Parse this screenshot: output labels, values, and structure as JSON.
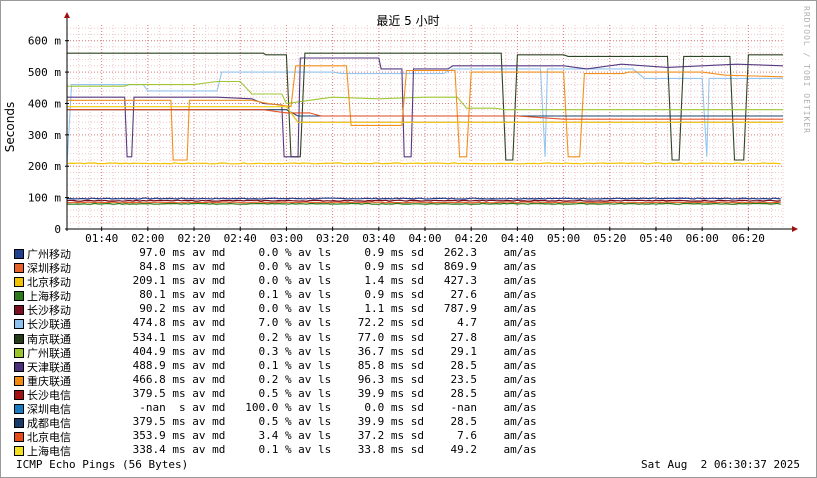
{
  "chart_data": {
    "type": "line",
    "title": "最近 5 小时",
    "ylabel": "Seconds",
    "side_label": "RRDTOOL / TOBI OETIKER",
    "ylim": [
      0,
      650
    ],
    "yticks": [
      0,
      100,
      200,
      300,
      400,
      500,
      600
    ],
    "ytick_labels": [
      "0",
      "100 m",
      "200 m",
      "300 m",
      "400 m",
      "500 m",
      "600 m"
    ],
    "x_start_minutes": 85,
    "x_end_minutes": 395,
    "x_tick_minutes": [
      100,
      120,
      140,
      160,
      180,
      200,
      220,
      240,
      260,
      280,
      300,
      320,
      340,
      360,
      380
    ],
    "xtick_labels": [
      "01:40",
      "02:00",
      "02:20",
      "02:40",
      "03:00",
      "03:20",
      "03:40",
      "04:00",
      "04:20",
      "04:40",
      "05:00",
      "05:20",
      "05:40",
      "06:00",
      "06:20"
    ],
    "grid": true,
    "series": [
      {
        "name": "广州移动",
        "color": "#1f3f8f",
        "kind": "flat",
        "base": 97,
        "stats": "  97.0 ms av md     0.0 % av ls     0.9 ms sd   262.3    am/as"
      },
      {
        "name": "深圳移动",
        "color": "#e8602a",
        "kind": "flat",
        "base": 84.8,
        "stats": "  84.8 ms av md     0.0 % av ls     0.9 ms sd   869.9    am/as"
      },
      {
        "name": "北京移动",
        "color": "#f2c200",
        "kind": "flat",
        "base": 209.1,
        "stats": " 209.1 ms av md     0.0 % av ls     1.4 ms sd   427.3    am/as"
      },
      {
        "name": "上海移动",
        "color": "#2c7a1a",
        "kind": "flat",
        "base": 80.1,
        "stats": "  80.1 ms av md     0.1 % av ls     0.9 ms sd    27.6    am/as"
      },
      {
        "name": "长沙移动",
        "color": "#7a0f1f",
        "kind": "flat",
        "base": 90.2,
        "stats": "  90.2 ms av md     0.0 % av ls     1.1 ms sd   787.9    am/as"
      },
      {
        "name": "长沙联通",
        "color": "#8fc3ef",
        "kind": "step",
        "points": [
          [
            85,
            205
          ],
          [
            87,
            460
          ],
          [
            118,
            460
          ],
          [
            120,
            440
          ],
          [
            150,
            440
          ],
          [
            152,
            500
          ],
          [
            200,
            500
          ],
          [
            204,
            495
          ],
          [
            248,
            495
          ],
          [
            252,
            510
          ],
          [
            290,
            510
          ],
          [
            292,
            230
          ],
          [
            293,
            510
          ],
          [
            330,
            510
          ],
          [
            335,
            480
          ],
          [
            360,
            480
          ],
          [
            362,
            230
          ],
          [
            363,
            480
          ],
          [
            395,
            480
          ]
        ],
        "stats": " 474.8 ms av md     7.0 % av ls    72.2 ms sd     4.7    am/as"
      },
      {
        "name": "南京联通",
        "color": "#243a18",
        "kind": "step",
        "points": [
          [
            85,
            560
          ],
          [
            170,
            560
          ],
          [
            171,
            555
          ],
          [
            180,
            555
          ],
          [
            182,
            230
          ],
          [
            186,
            230
          ],
          [
            188,
            560
          ],
          [
            273,
            560
          ],
          [
            275,
            220
          ],
          [
            278,
            220
          ],
          [
            280,
            555
          ],
          [
            300,
            555
          ],
          [
            302,
            550
          ],
          [
            345,
            550
          ],
          [
            347,
            220
          ],
          [
            350,
            220
          ],
          [
            352,
            550
          ],
          [
            372,
            550
          ],
          [
            374,
            220
          ],
          [
            378,
            220
          ],
          [
            380,
            555
          ],
          [
            395,
            555
          ]
        ],
        "stats": " 534.1 ms av md     0.2 % av ls    77.0 ms sd    27.8    am/as"
      },
      {
        "name": "广州联通",
        "color": "#9ac52a",
        "kind": "step",
        "points": [
          [
            85,
            455
          ],
          [
            110,
            455
          ],
          [
            112,
            460
          ],
          [
            140,
            460
          ],
          [
            150,
            470
          ],
          [
            160,
            470
          ],
          [
            165,
            430
          ],
          [
            178,
            430
          ],
          [
            180,
            400
          ],
          [
            190,
            410
          ],
          [
            200,
            420
          ],
          [
            220,
            415
          ],
          [
            240,
            420
          ],
          [
            254,
            420
          ],
          [
            258,
            385
          ],
          [
            270,
            385
          ],
          [
            275,
            380
          ],
          [
            395,
            380
          ]
        ],
        "stats": " 404.9 ms av md     0.3 % av ls    36.7 ms sd    29.1    am/as"
      },
      {
        "name": "天津联通",
        "color": "#4c2f7a",
        "kind": "step",
        "points": [
          [
            85,
            420
          ],
          [
            110,
            420
          ],
          [
            111,
            230
          ],
          [
            113,
            230
          ],
          [
            114,
            420
          ],
          [
            150,
            420
          ],
          [
            165,
            415
          ],
          [
            170,
            400
          ],
          [
            178,
            395
          ],
          [
            179,
            230
          ],
          [
            185,
            230
          ],
          [
            186,
            545
          ],
          [
            220,
            545
          ],
          [
            221,
            510
          ],
          [
            230,
            510
          ],
          [
            231,
            230
          ],
          [
            234,
            230
          ],
          [
            235,
            510
          ],
          [
            250,
            510
          ],
          [
            252,
            520
          ],
          [
            300,
            520
          ],
          [
            310,
            510
          ],
          [
            325,
            525
          ],
          [
            345,
            515
          ],
          [
            375,
            525
          ],
          [
            395,
            520
          ]
        ],
        "stats": " 488.9 ms av md     0.1 % av ls    85.8 ms sd    28.5    am/as"
      },
      {
        "name": "重庆联通",
        "color": "#f08a10",
        "kind": "step",
        "points": [
          [
            85,
            410
          ],
          [
            130,
            410
          ],
          [
            131,
            220
          ],
          [
            137,
            220
          ],
          [
            138,
            410
          ],
          [
            165,
            410
          ],
          [
            172,
            400
          ],
          [
            182,
            390
          ],
          [
            184,
            520
          ],
          [
            206,
            520
          ],
          [
            208,
            330
          ],
          [
            230,
            330
          ],
          [
            232,
            505
          ],
          [
            253,
            505
          ],
          [
            255,
            230
          ],
          [
            258,
            230
          ],
          [
            260,
            500
          ],
          [
            300,
            500
          ],
          [
            302,
            230
          ],
          [
            307,
            230
          ],
          [
            309,
            495
          ],
          [
            326,
            495
          ],
          [
            328,
            500
          ],
          [
            360,
            500
          ],
          [
            370,
            490
          ],
          [
            395,
            485
          ]
        ],
        "stats": " 466.8 ms av md     0.2 % av ls    96.3 ms sd    23.5    am/as"
      },
      {
        "name": "长沙电信",
        "color": "#a01010",
        "kind": "step",
        "points": [
          [
            85,
            390
          ],
          [
            180,
            390
          ],
          [
            185,
            340
          ],
          [
            395,
            340
          ]
        ],
        "stats": " 379.5 ms av md     0.5 % av ls    39.9 ms sd    28.5    am/as"
      },
      {
        "name": "深圳电信",
        "color": "#1a7ac0",
        "kind": "none",
        "stats": "  -nan  s av md   100.0 % av ls     0.0 ms sd    -nan    am/as"
      },
      {
        "name": "成都电信",
        "color": "#163a6a",
        "kind": "step",
        "points": [
          [
            85,
            380
          ],
          [
            180,
            380
          ],
          [
            185,
            360
          ],
          [
            395,
            360
          ]
        ],
        "stats": " 379.5 ms av md     0.5 % av ls    39.9 ms sd    28.5    am/as"
      },
      {
        "name": "北京电信",
        "color": "#e84a1a",
        "kind": "step",
        "points": [
          [
            85,
            380
          ],
          [
            170,
            380
          ],
          [
            180,
            370
          ],
          [
            190,
            370
          ],
          [
            195,
            360
          ],
          [
            280,
            360
          ],
          [
            300,
            350
          ],
          [
            395,
            350
          ]
        ],
        "stats": " 353.9 ms av md     3.4 % av ls    37.2 ms sd     7.6    am/as"
      },
      {
        "name": "上海电信",
        "color": "#f5e020",
        "kind": "step",
        "points": [
          [
            85,
            390
          ],
          [
            180,
            390
          ],
          [
            185,
            340
          ],
          [
            395,
            340
          ]
        ],
        "stats": " 338.4 ms av md     0.1 % av ls    33.8 ms sd    49.2    am/as"
      }
    ]
  },
  "footer": {
    "left": "ICMP Echo Pings (56 Bytes)",
    "right": "Sat Aug  2 06:30:37 2025"
  }
}
